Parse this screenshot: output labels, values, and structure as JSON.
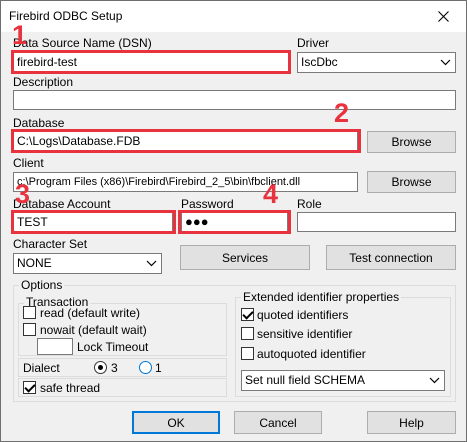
{
  "window": {
    "title": "Firebird ODBC Setup",
    "close_glyph": "✕"
  },
  "dsn": {
    "label": "Data Source Name (DSN)",
    "value": "firebird-test"
  },
  "driver": {
    "label": "Driver",
    "value": "IscDbc"
  },
  "description": {
    "label": "Description",
    "value": ""
  },
  "database": {
    "label": "Database",
    "value": "C:\\Logs\\Database.FDB",
    "browse": "Browse"
  },
  "client": {
    "label": "Client",
    "value": "c:\\Program Files (x86)\\Firebird\\Firebird_2_5\\bin\\fbclient.dll",
    "browse": "Browse"
  },
  "account": {
    "label": "Database Account",
    "value": "TEST"
  },
  "password": {
    "label": "Password",
    "value": "●●●"
  },
  "role": {
    "label": "Role",
    "value": ""
  },
  "charset": {
    "label": "Character Set",
    "value": "NONE"
  },
  "buttons": {
    "services": "Services",
    "test_connection": "Test connection",
    "ok": "OK",
    "cancel": "Cancel",
    "help": "Help"
  },
  "options": {
    "label": "Options",
    "transaction": {
      "label": "Transaction",
      "read": "read (default write)",
      "read_checked": false,
      "nowait": "nowait (default wait)",
      "nowait_checked": false,
      "lock_timeout_value": "",
      "lock_timeout": "Lock Timeout"
    },
    "dialect": {
      "label": "Dialect",
      "opt3": "3",
      "opt1": "1",
      "selected": "3"
    },
    "safe_thread": {
      "label": "safe thread",
      "checked": true
    },
    "extended": {
      "label": "Extended identifier properties",
      "quoted": "quoted identifiers",
      "quoted_checked": true,
      "sensitive": "sensitive identifier",
      "sensitive_checked": false,
      "autoquoted": "autoquoted identifier",
      "autoquoted_checked": false,
      "null_field": "Set null field SCHEMA"
    }
  },
  "annotations": [
    "1",
    "2",
    "3",
    "4"
  ],
  "colors": {
    "highlight": "#e8333e",
    "focus": "#0078d7",
    "window_bg": "#f0f0f0"
  }
}
